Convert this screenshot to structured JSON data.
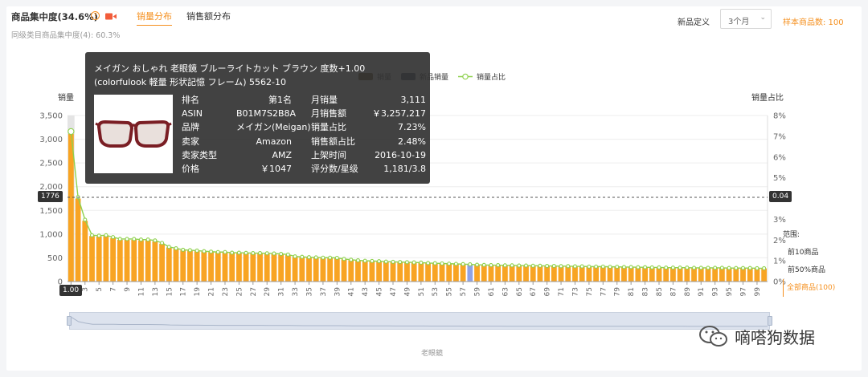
{
  "header": {
    "title": "商品集中度(34.6%)",
    "help_icon_glyph": "?",
    "tabs": [
      {
        "label": "销量分布",
        "active": true
      },
      {
        "label": "销售额分布",
        "active": false
      }
    ],
    "subline": "同级类目商品集中度(4):  60.3%",
    "new_product_label": "新品定义",
    "period_select": "3个月",
    "sample_label": "样本商品数: 100"
  },
  "legend": [
    {
      "label": "销量",
      "color": "#6b4a1e",
      "kind": "box"
    },
    {
      "label": "新品销量",
      "color": "#3d4a6b",
      "kind": "box"
    },
    {
      "label": "销量占比",
      "color": "#8fd14f",
      "kind": "line"
    }
  ],
  "range": {
    "title": "范围:",
    "items": [
      "前10商品",
      "前50%商品"
    ],
    "all": "全部商品(100)"
  },
  "tooltip": {
    "title": "メイガン おしゃれ 老眼鏡 ブルーライトカット ブラウン 度数+1.00 (colorfulook 軽量 形状記憶 フレーム) 5562-10",
    "left_rows": [
      {
        "k": "排名",
        "v": "第1名"
      },
      {
        "k": "ASIN",
        "v": "B01M7S2B8A"
      },
      {
        "k": "品牌",
        "v": "メイガン(Meigan)"
      },
      {
        "k": "卖家",
        "v": "Amazon"
      },
      {
        "k": "卖家类型",
        "v": "AMZ"
      },
      {
        "k": "价格",
        "v": "￥1047"
      }
    ],
    "right_rows": [
      {
        "k": "月销量",
        "v": "3,111"
      },
      {
        "k": "月销售额",
        "v": "￥3,257,217"
      },
      {
        "k": "销量占比",
        "v": "7.23%"
      },
      {
        "k": "销售额占比",
        "v": "2.48%"
      },
      {
        "k": "上架时间",
        "v": "2016-10-19"
      },
      {
        "k": "评分数/星级",
        "v": "1,181/3.8"
      }
    ]
  },
  "badges": {
    "left_value": "1776",
    "right_value": "0.04",
    "x_value": "1.00"
  },
  "slider": {
    "category_label": "老眼鏡"
  },
  "watermark": "嘀嗒狗数据",
  "colors": {
    "accent": "#f5901f",
    "bar": "#f8a423",
    "new_bar": "#8fa3e6",
    "line": "#8fd14f"
  },
  "chart_data": {
    "type": "bar",
    "xlabel": "",
    "ylabel": "销量",
    "y2label": "销量占比",
    "ylim": [
      0,
      3500
    ],
    "y_ticks": [
      0,
      500,
      1000,
      1500,
      2000,
      2500,
      3000,
      3500
    ],
    "y_tick_labels": [
      "0",
      "500",
      "1,000",
      "1,500",
      "2,000",
      "2,500",
      "3,000",
      "3,500"
    ],
    "y2lim": [
      0,
      8
    ],
    "y2_ticks": [
      0,
      1,
      2,
      3,
      4,
      5,
      6,
      7,
      8
    ],
    "y2_tick_labels": [
      "0%",
      "1%",
      "2%",
      "3%",
      "4%",
      "5%",
      "6%",
      "7%",
      "8%"
    ],
    "x_tick_labels": [
      "1",
      "3",
      "5",
      "7",
      "9",
      "11",
      "13",
      "15",
      "17",
      "19",
      "21",
      "23",
      "25",
      "27",
      "29",
      "31",
      "33",
      "35",
      "37",
      "39",
      "41",
      "43",
      "45",
      "47",
      "49",
      "51",
      "53",
      "55",
      "57",
      "59",
      "61",
      "63",
      "65",
      "67",
      "69",
      "71",
      "73",
      "75",
      "77",
      "79",
      "81",
      "83",
      "85",
      "87",
      "89",
      "91",
      "93",
      "95",
      "97",
      "99"
    ],
    "highlight_rank": 1,
    "new_product_ranks": [
      58
    ],
    "series": [
      {
        "name": "销量",
        "values": [
          3111,
          1750,
          1280,
          960,
          950,
          960,
          920,
          880,
          880,
          880,
          870,
          870,
          850,
          800,
          720,
          690,
          660,
          650,
          640,
          630,
          620,
          610,
          610,
          600,
          600,
          595,
          590,
          590,
          585,
          580,
          570,
          560,
          520,
          510,
          505,
          500,
          495,
          495,
          490,
          470,
          450,
          440,
          430,
          425,
          420,
          415,
          410,
          405,
          400,
          395,
          390,
          385,
          380,
          375,
          370,
          365,
          360,
          355,
          350,
          345,
          340,
          338,
          336,
          334,
          332,
          330,
          328,
          326,
          324,
          322,
          320,
          318,
          316,
          314,
          312,
          310,
          308,
          306,
          304,
          302,
          300,
          298,
          296,
          294,
          292,
          290,
          289,
          288,
          287,
          286,
          285,
          284,
          283,
          282,
          281,
          280,
          279,
          278,
          277,
          276
        ]
      },
      {
        "name": "销量占比",
        "values": [
          7.23,
          4.07,
          2.98,
          2.23,
          2.21,
          2.23,
          2.14,
          2.05,
          2.05,
          2.05,
          2.02,
          2.02,
          1.98,
          1.86,
          1.67,
          1.6,
          1.53,
          1.51,
          1.49,
          1.46,
          1.44,
          1.42,
          1.42,
          1.39,
          1.39,
          1.38,
          1.37,
          1.37,
          1.36,
          1.35,
          1.33,
          1.3,
          1.21,
          1.19,
          1.17,
          1.16,
          1.15,
          1.15,
          1.14,
          1.09,
          1.05,
          1.02,
          1.0,
          0.99,
          0.98,
          0.96,
          0.95,
          0.94,
          0.93,
          0.92,
          0.91,
          0.89,
          0.88,
          0.87,
          0.86,
          0.85,
          0.84,
          0.83,
          0.81,
          0.8,
          0.79,
          0.79,
          0.78,
          0.78,
          0.77,
          0.77,
          0.76,
          0.76,
          0.75,
          0.75,
          0.74,
          0.74,
          0.73,
          0.73,
          0.72,
          0.72,
          0.72,
          0.71,
          0.71,
          0.7,
          0.7,
          0.69,
          0.69,
          0.68,
          0.68,
          0.67,
          0.67,
          0.67,
          0.67,
          0.66,
          0.66,
          0.66,
          0.66,
          0.66,
          0.65,
          0.65,
          0.65,
          0.65,
          0.64,
          0.64
        ]
      }
    ]
  }
}
